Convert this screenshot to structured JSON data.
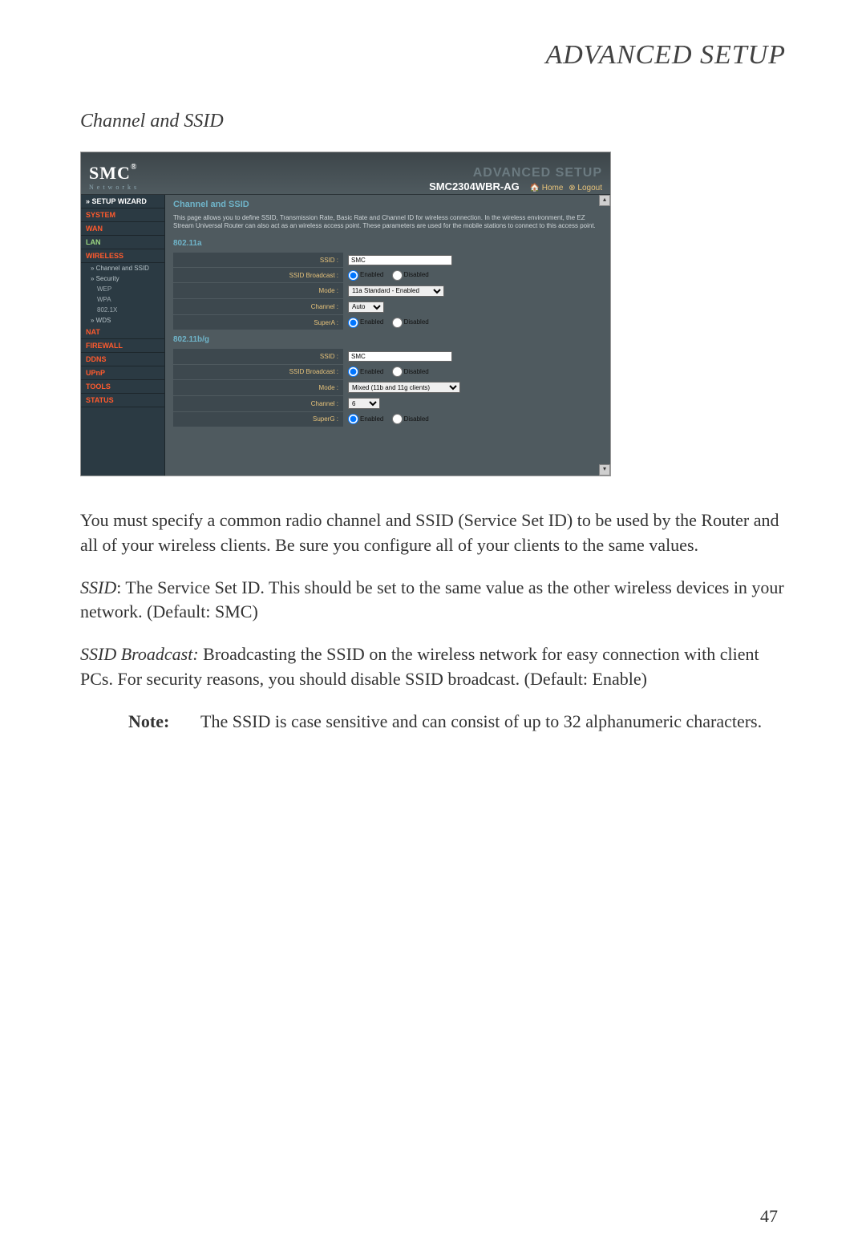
{
  "doc": {
    "title": "ADVANCED SETUP",
    "section_title": "Channel and SSID",
    "page_number": "47",
    "para1": "You must specify a common radio channel and SSID (Service Set ID) to be used by the Router and all of your wireless clients. Be sure you configure all of your clients to the same values.",
    "ssid_label": "SSID",
    "ssid_text": ": The Service Set ID. This should be set to the same value as the other wireless devices in your network. (Default: SMC)",
    "broadcast_label": "SSID Broadcast:",
    "broadcast_text": " Broadcasting the SSID on the wireless network for easy connection with client PCs. For security reasons, you should disable SSID broadcast. (Default: Enable)",
    "note_label": "Note:",
    "note_text": "The SSID is case sensitive and can consist of up to 32 alphanumeric characters."
  },
  "router": {
    "brand": "SMC",
    "brand_sup": "®",
    "brand_sub": "N e t w o r k s",
    "adv_label": "ADVANCED SETUP",
    "model": "SMC2304WBR-AG",
    "home_icon": "🏠",
    "home": "Home",
    "logout_icon": "⊗",
    "logout": "Logout",
    "sidebar": {
      "setup_wizard": "» SETUP WIZARD",
      "system": "SYSTEM",
      "wan": "WAN",
      "lan": "LAN",
      "wireless": "WIRELESS",
      "channel_ssid": "» Channel and SSID",
      "security": "» Security",
      "wep": "WEP",
      "wpa": "WPA",
      "dot1x": "802.1X",
      "wds": "» WDS",
      "nat": "NAT",
      "firewall": "FIREWALL",
      "ddns": "DDNS",
      "upnp": "UPnP",
      "tools": "TOOLS",
      "status": "STATUS"
    },
    "content": {
      "title": "Channel and SSID",
      "desc": "This page allows you to define SSID, Transmission Rate, Basic Rate and Channel ID for wireless connection. In the wireless environment, the EZ Stream Universal Router can also act as an wireless access point. These parameters are used for the mobile stations to connect to this access point.",
      "band_a": "802.11a",
      "band_bg": "802.11b/g",
      "labels": {
        "ssid": "SSID :",
        "ssid_broadcast": "SSID Broadcast :",
        "mode": "Mode :",
        "channel": "Channel :",
        "superA": "SuperA :",
        "superG": "SuperG :"
      },
      "values": {
        "ssid_a": "SMC",
        "mode_a": "11a Standard - Enabled",
        "channel_a": "Auto",
        "ssid_bg": "SMC",
        "mode_bg": "Mixed (11b and 11g clients)",
        "channel_bg": "6"
      },
      "radio": {
        "enabled": "Enabled",
        "disabled": "Disabled"
      }
    }
  }
}
